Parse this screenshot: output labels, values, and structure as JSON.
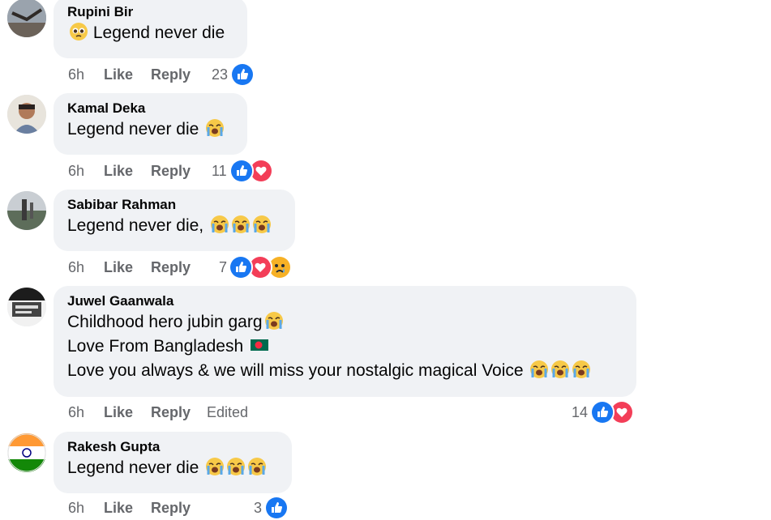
{
  "comments": [
    {
      "author": "Rupini Bir",
      "lines": [
        "Legend never die"
      ],
      "time": "6h",
      "like_label": "Like",
      "reply_label": "Reply",
      "reaction_count": "23",
      "reactions": [
        "like-icon"
      ]
    },
    {
      "author": "Kamal Deka",
      "lines": [
        "Legend never die"
      ],
      "time": "6h",
      "like_label": "Like",
      "reply_label": "Reply",
      "reaction_count": "11",
      "reactions": [
        "like-icon",
        "love-icon"
      ]
    },
    {
      "author": "Sabibar Rahman",
      "lines": [
        "Legend never die,"
      ],
      "time": "6h",
      "like_label": "Like",
      "reply_label": "Reply",
      "reaction_count": "7",
      "reactions": [
        "like-icon",
        "love-icon",
        "sad-icon"
      ]
    },
    {
      "author": "Juwel Gaanwala",
      "lines": [
        "Childhood hero jubin garg",
        "Love From Bangladesh",
        "Love you always & we will miss your nostalgic magical Voice"
      ],
      "time": "6h",
      "like_label": "Like",
      "reply_label": "Reply",
      "edited_label": "Edited",
      "reaction_count": "14",
      "reactions": [
        "like-icon",
        "love-icon"
      ]
    },
    {
      "author": "Rakesh Gupta",
      "lines": [
        "Legend never die"
      ],
      "time": "6h",
      "like_label": "Like",
      "reply_label": "Reply",
      "reaction_count": "3",
      "reactions": [
        "like-icon"
      ]
    }
  ],
  "colors": {
    "like": "#1877f2",
    "love": "#f33e58",
    "sad": "#f7b125",
    "bubble": "#f0f2f5",
    "meta": "#65676b"
  }
}
